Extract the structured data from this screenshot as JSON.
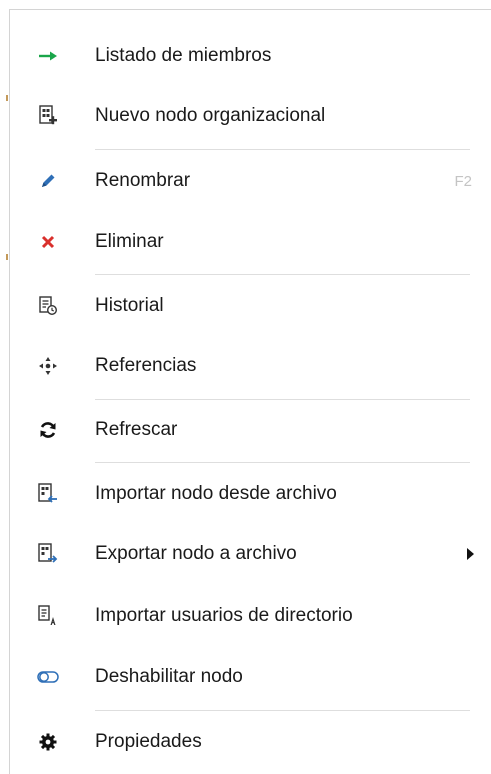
{
  "menu": {
    "items": [
      {
        "label": "Listado de miembros",
        "icon": "arrow-right-icon"
      },
      {
        "label": "Nuevo nodo organizacional",
        "icon": "new-node-icon"
      },
      {
        "label": "Renombrar",
        "icon": "pencil-icon",
        "shortcut": "F2"
      },
      {
        "label": "Eliminar",
        "icon": "delete-x-icon"
      },
      {
        "label": "Historial",
        "icon": "history-icon"
      },
      {
        "label": "Referencias",
        "icon": "references-icon"
      },
      {
        "label": "Refrescar",
        "icon": "refresh-icon"
      },
      {
        "label": "Importar nodo desde archivo",
        "icon": "import-file-icon"
      },
      {
        "label": "Exportar nodo a archivo",
        "icon": "export-file-icon",
        "has_submenu": true
      },
      {
        "label": "Importar usuarios de directorio",
        "icon": "import-users-icon"
      },
      {
        "label": "Deshabilitar nodo",
        "icon": "toggle-icon"
      },
      {
        "label": "Propiedades",
        "icon": "gear-icon"
      }
    ]
  },
  "colors": {
    "arrow_green": "#1aa64a",
    "pencil_blue": "#2e6fb7",
    "delete_red": "#d9302c",
    "separator": "#dedede",
    "shortcut_gray": "#c4c4c4"
  }
}
